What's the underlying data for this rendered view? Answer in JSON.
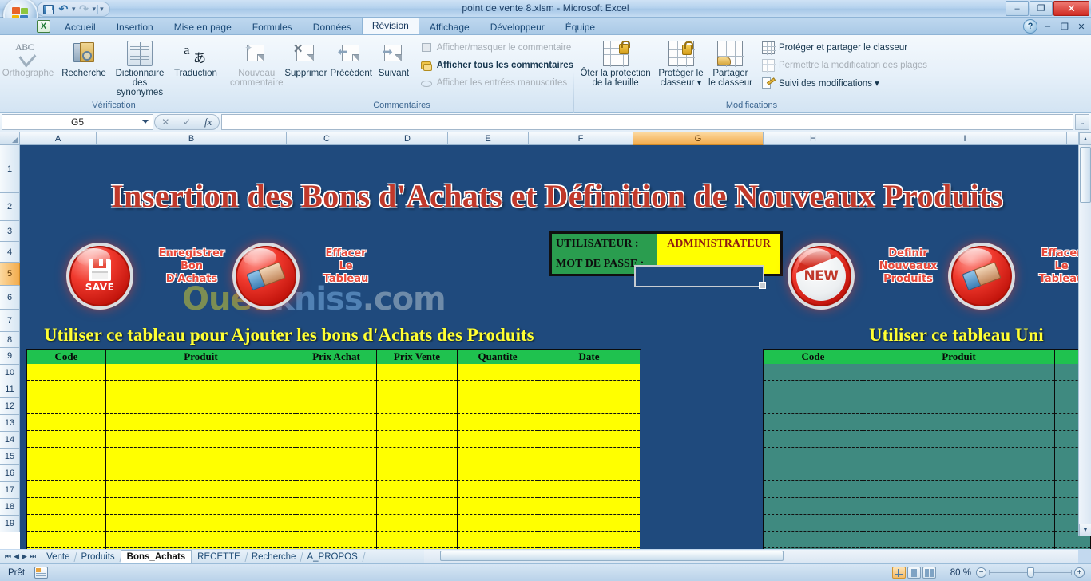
{
  "window": {
    "title": "point de vente 8.xlsm - Microsoft Excel",
    "minimize": "–",
    "maximize": "❐",
    "close": "✕"
  },
  "quick_access": {
    "save": "save-icon",
    "undo": "↶",
    "redo": "↷",
    "customize": "▾"
  },
  "ribbon": {
    "tabs": [
      {
        "label": "Accueil",
        "active": false
      },
      {
        "label": "Insertion",
        "active": false
      },
      {
        "label": "Mise en page",
        "active": false
      },
      {
        "label": "Formules",
        "active": false
      },
      {
        "label": "Données",
        "active": false
      },
      {
        "label": "Révision",
        "active": true
      },
      {
        "label": "Affichage",
        "active": false
      },
      {
        "label": "Développeur",
        "active": false
      },
      {
        "label": "Équipe",
        "active": false
      }
    ],
    "groups": [
      {
        "name": "Vérification",
        "buttons": [
          {
            "label": "Orthographe",
            "disabled": true
          },
          {
            "label": "Recherche",
            "disabled": false
          },
          {
            "label": "Dictionnaire\ndes synonymes",
            "line1": "Dictionnaire",
            "line2": "des synonymes",
            "disabled": false
          },
          {
            "label": "Traduction",
            "disabled": false
          }
        ]
      },
      {
        "name": "Commentaires",
        "buttons": [
          {
            "line1": "Nouveau",
            "line2": "commentaire",
            "disabled": true
          },
          {
            "line1": "Supprimer",
            "line2": "",
            "disabled": false
          },
          {
            "line1": "Précédent",
            "line2": "",
            "disabled": false
          },
          {
            "line1": "Suivant",
            "line2": "",
            "disabled": false
          }
        ],
        "small_items": [
          {
            "label": "Afficher/masquer le commentaire",
            "disabled": true,
            "bold": false
          },
          {
            "label": "Afficher tous les commentaires",
            "disabled": false,
            "bold": true
          },
          {
            "label": "Afficher les entrées manuscrites",
            "disabled": true,
            "bold": false
          }
        ]
      },
      {
        "name": "Modifications",
        "buttons": [
          {
            "line1": "Ôter la protection",
            "line2": "de la feuille",
            "disabled": false
          },
          {
            "line1": "Protéger le",
            "line2": "classeur ▾",
            "disabled": false
          },
          {
            "line1": "Partager",
            "line2": "le classeur",
            "disabled": false
          }
        ],
        "small_items": [
          {
            "label": "Protéger et partager le classeur",
            "disabled": false,
            "bold": false
          },
          {
            "label": "Permettre la modification des plages",
            "disabled": true,
            "bold": false
          },
          {
            "label": "Suivi des modifications ▾",
            "disabled": false,
            "bold": false
          }
        ]
      }
    ],
    "help_icon": "?",
    "minimize_ribbon": "–",
    "restore_ribbon": "❐",
    "close_window": "✕"
  },
  "formula_bar": {
    "name_box": "G5",
    "cancel": "✕",
    "confirm": "✓",
    "function": "fx",
    "value": "",
    "expand": "⌄"
  },
  "grid": {
    "columns": [
      "A",
      "B",
      "C",
      "D",
      "E",
      "F",
      "G",
      "H",
      "I"
    ],
    "selected_column": "G",
    "rows": [
      "1",
      "2",
      "3",
      "4",
      "5",
      "6",
      "7",
      "8",
      "9",
      "10",
      "11",
      "12",
      "13",
      "14",
      "15",
      "16",
      "17",
      "18",
      "19"
    ],
    "selected_row": "5",
    "selected_cell": "G5"
  },
  "sheet": {
    "banner_title": "Insertion des Bons d'Achats et Définition de Nouveaux Produits",
    "watermark": {
      "part1": "Oued",
      "part2": "kniss",
      "part3": ".com"
    },
    "buttons": [
      {
        "icon": "save-icon",
        "glyph": "SAVE",
        "label_lines": [
          "Enregistrer",
          "Bon",
          "D'Achats"
        ]
      },
      {
        "icon": "eraser-icon",
        "glyph": "",
        "label_lines": [
          "Effacer",
          "Le",
          "Tableau"
        ]
      },
      {
        "icon": "new-icon",
        "glyph": "NEW",
        "label_lines": [
          "Definir",
          "Nouveaux",
          "Produits"
        ]
      },
      {
        "icon": "eraser-icon",
        "glyph": "",
        "label_lines": [
          "Effacer",
          "Le",
          "Tableau"
        ]
      }
    ],
    "login": {
      "user_label": "UTILISATEUR :",
      "password_label": "MOT DE PASSE :",
      "user_value": "ADMINISTRATEUR",
      "password_value": ""
    },
    "left_section_heading": "Utiliser ce tableau pour Ajouter les bons d'Achats des  Produits",
    "right_section_heading": "Utiliser ce tableau Uni",
    "left_table": {
      "headers": [
        "Code",
        "Produit",
        "Prix Achat",
        "Prix Vente",
        "Quantite",
        "Date"
      ],
      "rows": 12
    },
    "right_table": {
      "headers": [
        "Code",
        "Produit",
        ""
      ],
      "rows": 12
    }
  },
  "sheet_tabs": {
    "nav": {
      "first": "⏮",
      "prev": "◀",
      "next": "▶",
      "last": "⏭"
    },
    "items": [
      {
        "label": "Vente",
        "active": false
      },
      {
        "label": "Produits",
        "active": false
      },
      {
        "label": "Bons_Achats",
        "active": true
      },
      {
        "label": "RECETTE",
        "active": false
      },
      {
        "label": "Recherche",
        "active": false
      },
      {
        "label": "A_PROPOS",
        "active": false
      }
    ]
  },
  "status_bar": {
    "state": "Prêt",
    "macro_icon": "record-macro-icon",
    "view_modes": [
      "normal-view",
      "page-layout-view",
      "page-break-view"
    ],
    "active_view": "normal-view",
    "zoom": "80 %",
    "zoom_out": "−",
    "zoom_in": "+"
  },
  "colors": {
    "sheet_background": "#1f4a7d",
    "banner_text": "#c0392b",
    "heading_yellow": "#ffff33",
    "table_header_green": "#1fc24f",
    "cell_yellow": "#ffff00",
    "cell_teal": "#3f8a80",
    "login_green": "#2a9d4f",
    "login_value_red": "#8e1a12",
    "selection_orange": "#f2ab4c"
  }
}
